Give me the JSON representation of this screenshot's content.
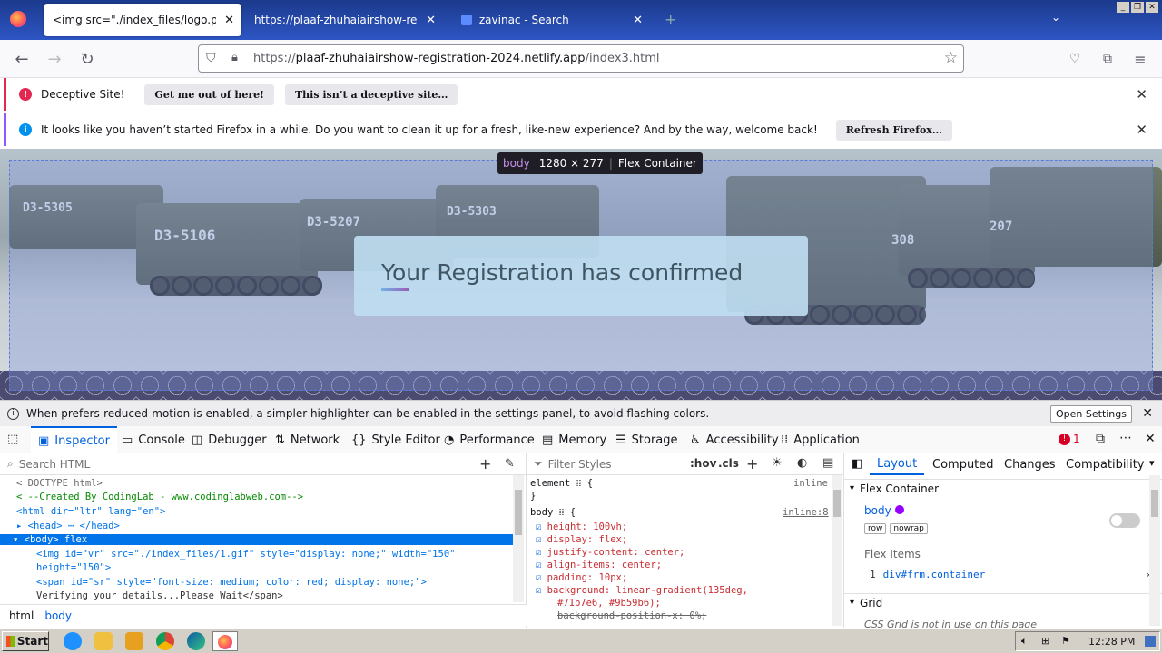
{
  "tabs": [
    {
      "label": "<img src=\"./index_files/logo.png\" alt=\"",
      "active": true
    },
    {
      "label": "https://plaaf-zhuhaiairshow-registratio",
      "active": false
    },
    {
      "label": "zavinac - Search",
      "active": false
    }
  ],
  "nav": {
    "url_prefix": "https://",
    "url_host": "plaaf-zhuhaiairshow-registration-2024.netlify.app",
    "url_path": "/index3.html"
  },
  "notif1": {
    "message": "Deceptive Site!",
    "btn1": "Get me out of here!",
    "btn2": "This isn’t a deceptive site…"
  },
  "notif2": {
    "message": "It looks like you haven’t started Firefox in a while. Do you want to clean it up for a fresh, like-new experience? And by the way, welcome back!",
    "btn": "Refresh Firefox…"
  },
  "page": {
    "heading": "Your Registration has confirmed",
    "tank_labels": [
      "D3-5305",
      "D3-5106",
      "D3-5207",
      "D3-5303",
      "308",
      "207"
    ]
  },
  "tooltip": {
    "tag": "body",
    "size": "1280 × 277",
    "type": "Flex Container"
  },
  "warning": {
    "text": "When prefers-reduced-motion is enabled, a simpler highlighter can be enabled in the settings panel, to avoid flashing colors.",
    "button": "Open Settings"
  },
  "devtools": {
    "tabs": [
      "Inspector",
      "Console",
      "Debugger",
      "Network",
      "Style Editor",
      "Performance",
      "Memory",
      "Storage",
      "Accessibility",
      "Application"
    ],
    "error_count": "1"
  },
  "html_panel": {
    "search_placeholder": "Search HTML",
    "lines": [
      "<!DOCTYPE html>",
      "<!--Created By CodingLab - www.codinglabweb.com-->",
      "<html dir=\"ltr\" lang=\"en\">",
      "<head> ⋯ </head>",
      "<body> flex",
      "<img id=\"vr\" src=\"./index_files/1.gif\" style=\"display: none;\" width=\"150\"",
      "height=\"150\">",
      "<span id=\"sr\" style=\"font-size: medium; color: red; display: none;\">",
      "Verifying your details...Please Wait</span>"
    ],
    "breadcrumb": [
      "html",
      "body"
    ]
  },
  "styles_panel": {
    "filter_placeholder": "Filter Styles",
    "hov": ":hov",
    ".cls": ".cls",
    "element_rule": "element",
    "inline": "inline",
    "body_rule": "body",
    "inline_ref": "inline:8",
    "props": [
      "height: 100vh;",
      "display: flex;",
      "justify-content: center;",
      "align-items: center;",
      "padding: 10px;",
      "background: linear-gradient(135deg,",
      "#71b7e6, #9b59b6);",
      "background-position-x: 0%;"
    ]
  },
  "layout_panel": {
    "tabs": [
      "Layout",
      "Computed",
      "Changes",
      "Compatibility"
    ],
    "flex_container": "Flex Container",
    "body": "body",
    "row": "row",
    "nowrap": "nowrap",
    "flex_items": "Flex Items",
    "item": "div#frm.container",
    "item_num": "1",
    "grid": "Grid",
    "grid_msg": "CSS Grid is not in use on this page"
  },
  "taskbar": {
    "start": "Start",
    "time": "12:28 PM"
  },
  "colors": {
    "accent": "#0060df",
    "gradient_start": "#71b7e6",
    "gradient_end": "#9b59b6"
  }
}
